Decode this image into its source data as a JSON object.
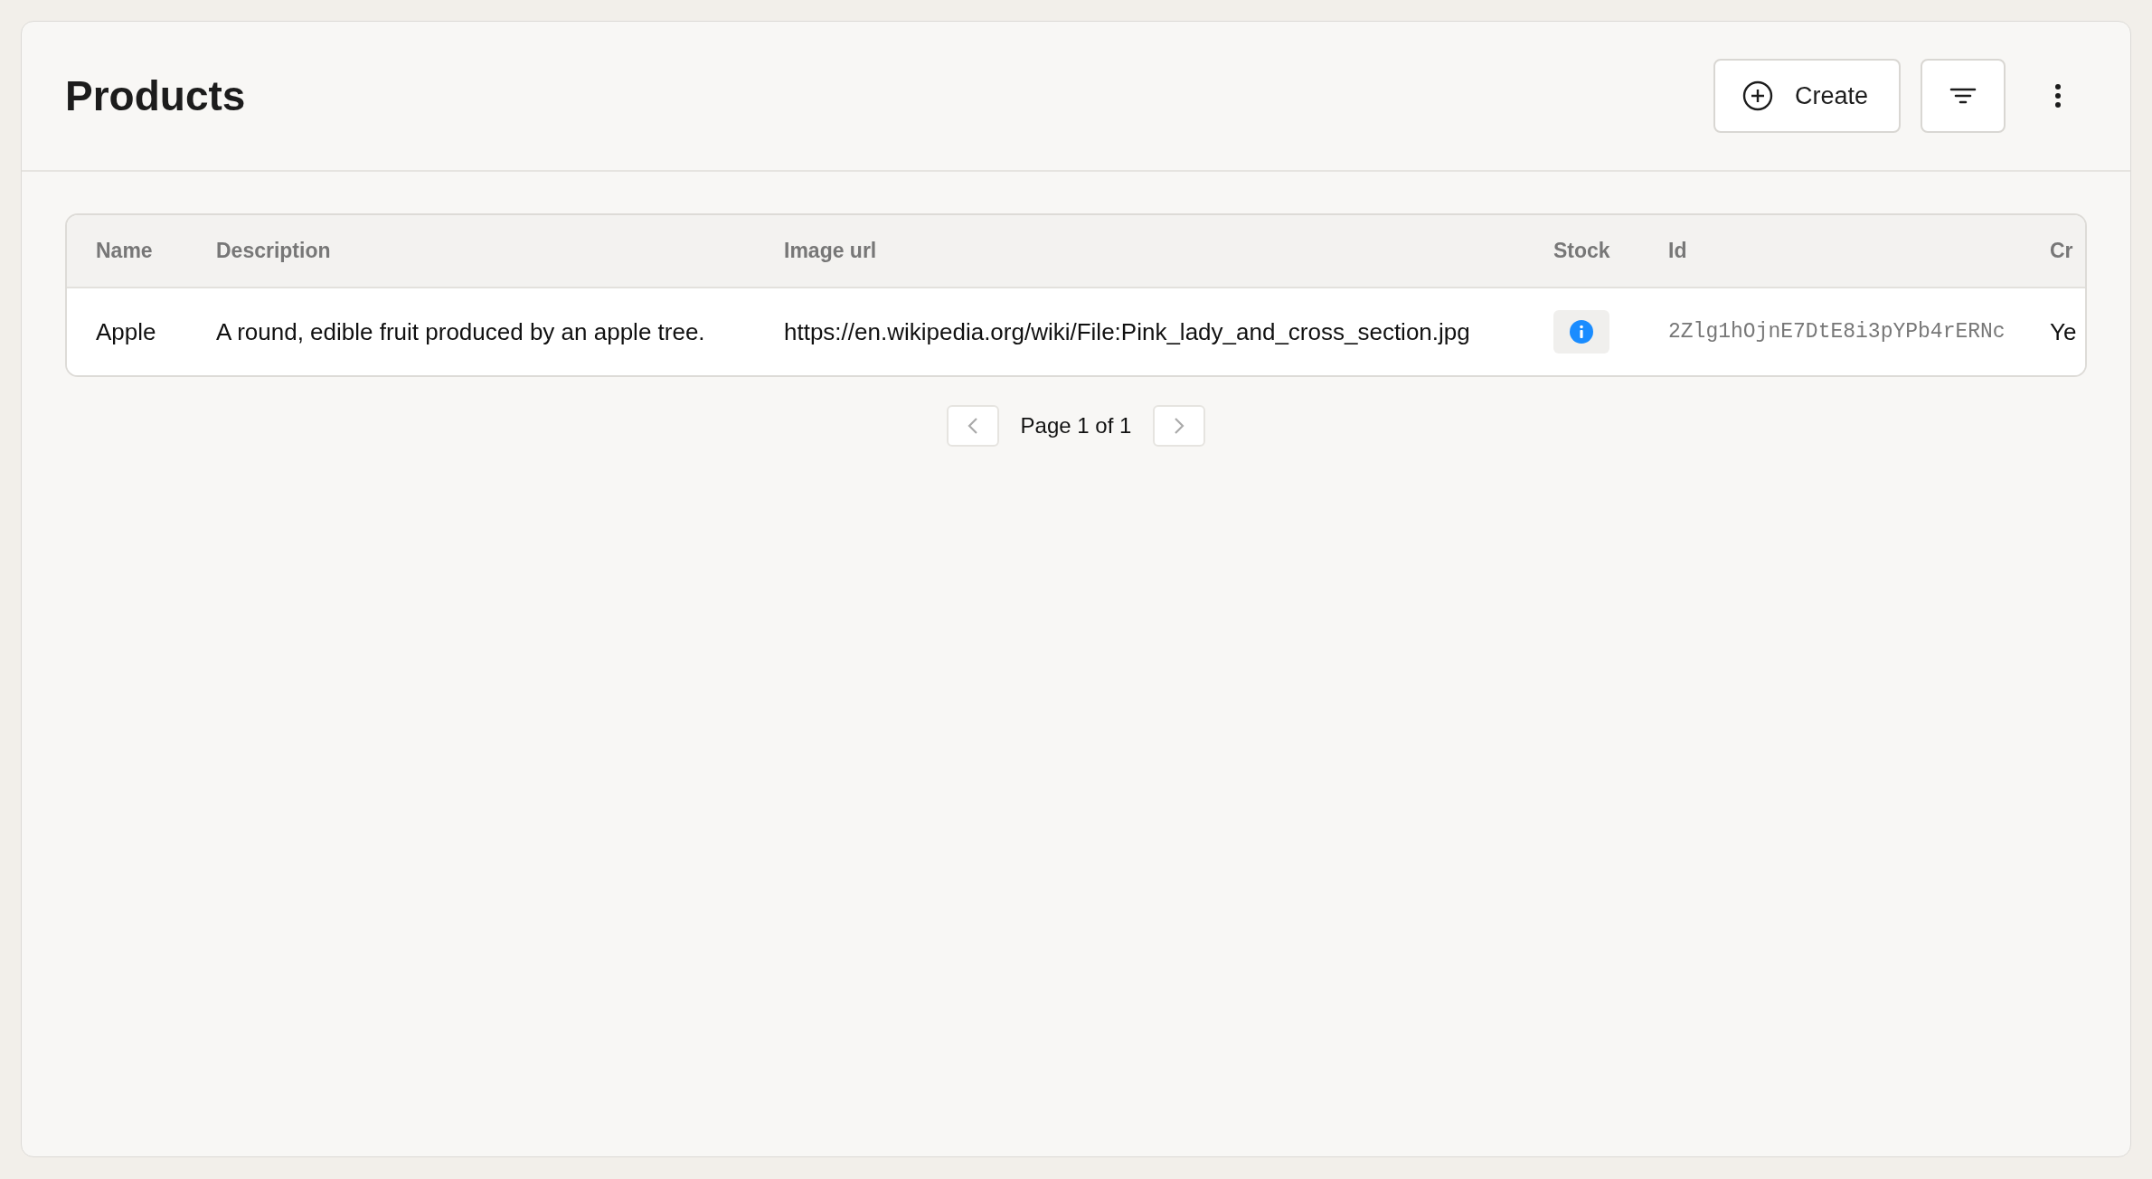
{
  "page": {
    "title": "Products"
  },
  "actions": {
    "create": "Create"
  },
  "table": {
    "columns": [
      "Name",
      "Description",
      "Image url",
      "Stock",
      "Id",
      "Cr"
    ],
    "rows": [
      {
        "name": "Apple",
        "description": "A round, edible fruit produced by an apple tree.",
        "image_url": "https://en.wikipedia.org/wiki/File:Pink_lady_and_cross_section.jpg",
        "stock": {
          "kind": "info"
        },
        "id": "2Zlg1hOjnE7DtE8i3pYPb4rERNc",
        "column_6": "Ye"
      }
    ]
  },
  "pagination": {
    "label": "Page 1 of 1"
  }
}
